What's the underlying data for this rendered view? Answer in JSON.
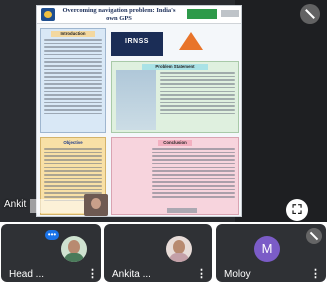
{
  "stage": {
    "presenter_name": "Ankit",
    "poster": {
      "title": "Overcoming navigation problem: India's own GPS",
      "irnss_label": "IRNSS",
      "introduction_heading": "Introduction",
      "objective_heading": "Objective",
      "problem_heading": "Problem Statement",
      "conclusion_heading": "Conclusion"
    },
    "expand_icon": "expand-icon",
    "mute_icon": "mic-off-icon"
  },
  "participants": [
    {
      "name": "Head ...",
      "more": "⋮",
      "avatar": "photo",
      "speaking": true
    },
    {
      "name": "Ankita ...",
      "more": "⋮",
      "avatar": "photo"
    },
    {
      "name": "Moloy",
      "more": "⋮",
      "avatar": "letter",
      "initial": "M",
      "muted": true
    }
  ],
  "colors": {
    "avatar_purple": "#7b5cc7",
    "speaking_blue": "#1a73e8",
    "tile_bg": "#2f3135"
  }
}
